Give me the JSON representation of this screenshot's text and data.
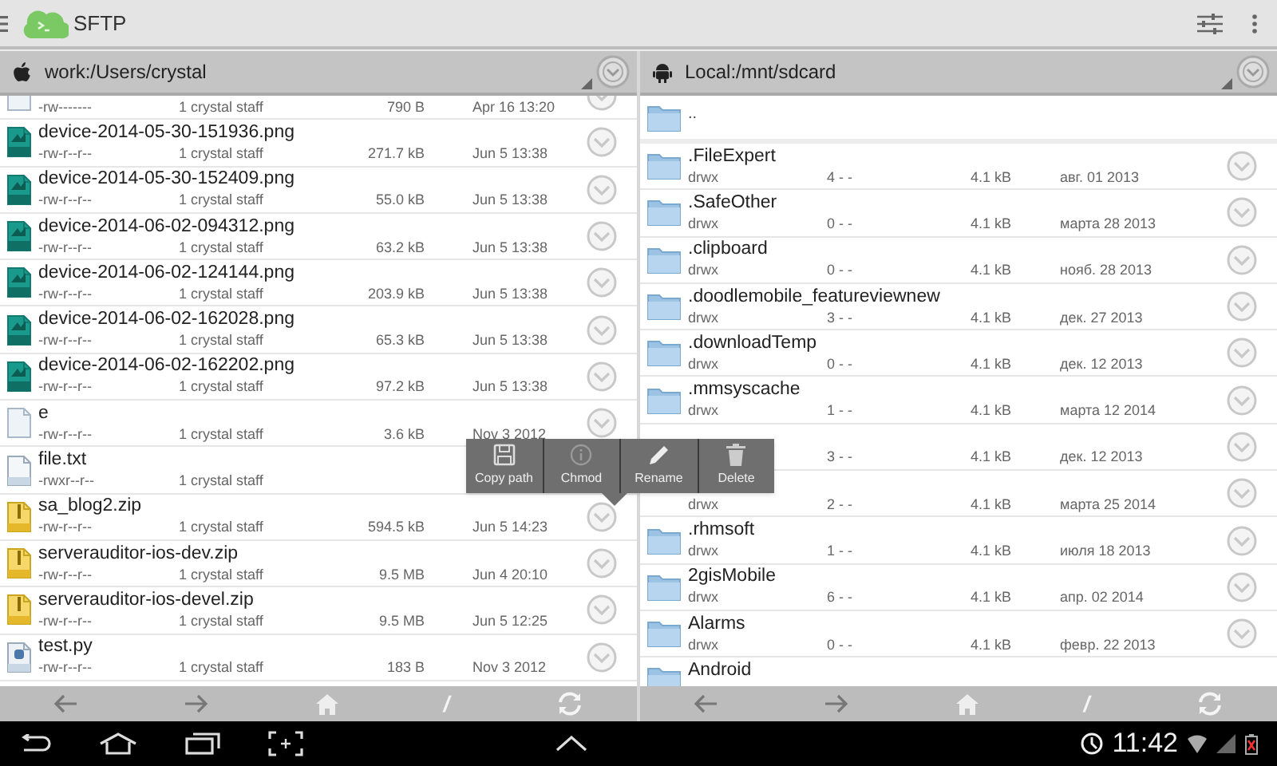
{
  "app_bar": {
    "title": "SFTP"
  },
  "left_panel": {
    "path": "work:/Users/crystal",
    "files": [
      {
        "kind": "doc",
        "perms": "-rw-------",
        "owner": "1 crystal staff",
        "size": "790 B",
        "date": "Apr 16 13:20"
      },
      {
        "kind": "png",
        "name": "device-2014-05-30-151936.png",
        "perms": "-rw-r--r--",
        "owner": "1 crystal staff",
        "size": "271.7 kB",
        "date": "Jun 5 13:38"
      },
      {
        "kind": "png",
        "name": "device-2014-05-30-152409.png",
        "perms": "-rw-r--r--",
        "owner": "1 crystal staff",
        "size": "55.0 kB",
        "date": "Jun 5 13:38"
      },
      {
        "kind": "png",
        "name": "device-2014-06-02-094312.png",
        "perms": "-rw-r--r--",
        "owner": "1 crystal staff",
        "size": "63.2 kB",
        "date": "Jun 5 13:38"
      },
      {
        "kind": "png",
        "name": "device-2014-06-02-124144.png",
        "perms": "-rw-r--r--",
        "owner": "1 crystal staff",
        "size": "203.9 kB",
        "date": "Jun 5 13:38"
      },
      {
        "kind": "png",
        "name": "device-2014-06-02-162028.png",
        "perms": "-rw-r--r--",
        "owner": "1 crystal staff",
        "size": "65.3 kB",
        "date": "Jun 5 13:38"
      },
      {
        "kind": "png",
        "name": "device-2014-06-02-162202.png",
        "perms": "-rw-r--r--",
        "owner": "1 crystal staff",
        "size": "97.2 kB",
        "date": "Jun 5 13:38"
      },
      {
        "kind": "doc",
        "name": "e",
        "perms": "-rw-r--r--",
        "owner": "1 crystal staff",
        "size": "3.6 kB",
        "date": "Nov 3 2012"
      },
      {
        "kind": "txt",
        "name": "file.txt",
        "perms": "-rwxr--r--",
        "owner": "1 crystal staff"
      },
      {
        "kind": "zip",
        "name": "sa_blog2.zip",
        "perms": "-rw-r--r--",
        "owner": "1 crystal staff",
        "size": "594.5 kB",
        "date": "Jun 5 14:23"
      },
      {
        "kind": "zip",
        "name": "serverauditor-ios-dev.zip",
        "perms": "-rw-r--r--",
        "owner": "1 crystal staff",
        "size": "9.5 MB",
        "date": "Jun 4 20:10"
      },
      {
        "kind": "zip",
        "name": "serverauditor-ios-devel.zip",
        "perms": "-rw-r--r--",
        "owner": "1 crystal staff",
        "size": "9.5 MB",
        "date": "Jun 5 12:25"
      },
      {
        "kind": "py",
        "name": "test.py",
        "perms": "-rw-r--r--",
        "owner": "1 crystal staff",
        "size": "183 B",
        "date": "Nov 3 2012"
      }
    ]
  },
  "right_panel": {
    "path": "Local:/mnt/sdcard",
    "parent": "..",
    "files": [
      {
        "name": ".FileExpert",
        "perms": "drwx",
        "owner": "4 - -",
        "size": "4.1 kB",
        "date": "авг. 01 2013"
      },
      {
        "name": ".SafeOther",
        "perms": "drwx",
        "owner": "0 - -",
        "size": "4.1 kB",
        "date": "марта 28 2013"
      },
      {
        "name": ".clipboard",
        "perms": "drwx",
        "owner": "0 - -",
        "size": "4.1 kB",
        "date": "нояб. 28 2013"
      },
      {
        "name": ".doodlemobile_featureviewnew",
        "perms": "drwx",
        "owner": "3 - -",
        "size": "4.1 kB",
        "date": "дек. 27 2013"
      },
      {
        "name": ".downloadTemp",
        "perms": "drwx",
        "owner": "0 - -",
        "size": "4.1 kB",
        "date": "дек. 12 2013"
      },
      {
        "name": ".mmsyscache",
        "perms": "drwx",
        "owner": "1 - -",
        "size": "4.1 kB",
        "date": "марта 12 2014"
      },
      {
        "owner": "3 - -",
        "size": "4.1 kB",
        "date": "дек. 12 2013"
      },
      {
        "perms": "drwx",
        "owner": "2 - -",
        "size": "4.1 kB",
        "date": "марта 25 2014"
      },
      {
        "name": ".rhmsoft",
        "perms": "drwx",
        "owner": "1 - -",
        "size": "4.1 kB",
        "date": "июля 18 2013"
      },
      {
        "name": "2gisMobile",
        "perms": "drwx",
        "owner": "6 - -",
        "size": "4.1 kB",
        "date": "апр. 02 2014"
      },
      {
        "name": "Alarms",
        "perms": "drwx",
        "owner": "0 - -",
        "size": "4.1 kB",
        "date": "февр. 22 2013"
      },
      {
        "name": "Android"
      }
    ]
  },
  "context_menu": [
    {
      "kind": "save",
      "label": "Copy path"
    },
    {
      "kind": "info",
      "label": "Chmod"
    },
    {
      "kind": "edit",
      "label": "Rename"
    },
    {
      "kind": "delete",
      "label": "Delete"
    }
  ],
  "toolbar": {
    "root": "/"
  },
  "system_bar": {
    "time": "11:42"
  }
}
